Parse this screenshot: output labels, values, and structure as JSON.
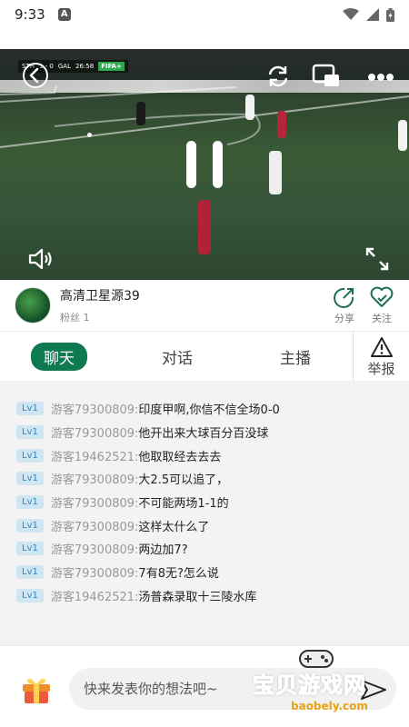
{
  "status_bar": {
    "time": "9:33",
    "notification_icon": "A"
  },
  "video": {
    "scoreboard": {
      "home": "STH",
      "score": "1 - 0",
      "away": "GAL",
      "clock": "26:58",
      "badge": "FIFA+"
    },
    "icons": [
      "back-icon",
      "rotate-icon",
      "pip-icon",
      "more-icon",
      "pause-icon",
      "volume-icon",
      "fullscreen-icon"
    ]
  },
  "streamer": {
    "name": "高清卫星源39",
    "fans": "粉丝 1",
    "share_label": "分享",
    "follow_label": "关注"
  },
  "tabs": [
    {
      "label": "聊天",
      "active": true
    },
    {
      "label": "对话",
      "active": false
    },
    {
      "label": "主播",
      "active": false
    }
  ],
  "report_label": "举报",
  "chat": [
    {
      "level": "Lv1",
      "user": "游客79300809:",
      "text": "印度甲啊,你信不信全场0-0"
    },
    {
      "level": "Lv1",
      "user": "游客79300809:",
      "text": "他开出来大球百分百没球"
    },
    {
      "level": "Lv1",
      "user": "游客19462521:",
      "text": "他取取经去去去"
    },
    {
      "level": "Lv1",
      "user": "游客79300809:",
      "text": "大2.5可以追了，"
    },
    {
      "level": "Lv1",
      "user": "游客79300809:",
      "text": "不可能两场1-1的"
    },
    {
      "level": "Lv1",
      "user": "游客79300809:",
      "text": "这样太什么了"
    },
    {
      "level": "Lv1",
      "user": "游客79300809:",
      "text": "两边加7?"
    },
    {
      "level": "Lv1",
      "user": "游客79300809:",
      "text": "7有8无?怎么说"
    },
    {
      "level": "Lv1",
      "user": "游客19462521:",
      "text": "汤普森录取十三陵水库"
    }
  ],
  "input": {
    "placeholder": "快来发表你的想法吧~"
  },
  "watermark": {
    "title": "宝贝游戏网",
    "url": "baobely.com"
  },
  "colors": {
    "accent": "#0f7a52",
    "level_bg": "#cfe6f2",
    "level_text": "#2d86c0",
    "chat_bg": "#f3f3f3"
  }
}
